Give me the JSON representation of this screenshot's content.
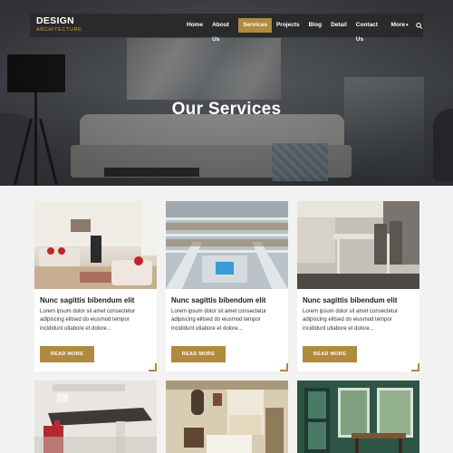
{
  "brand": {
    "name": "DESIGN",
    "tagline": "ARCHITECTURE"
  },
  "nav": {
    "items": [
      {
        "label": "Home",
        "active": false
      },
      {
        "label": "About Us",
        "active": false
      },
      {
        "label": "Services",
        "active": true
      },
      {
        "label": "Projects",
        "active": false
      },
      {
        "label": "Blog",
        "active": false
      },
      {
        "label": "Detail",
        "active": false
      },
      {
        "label": "Contact Us",
        "active": false
      },
      {
        "label": "More",
        "active": false
      }
    ],
    "search_icon": "search-icon"
  },
  "hero": {
    "title": "Our Services"
  },
  "cards": [
    {
      "title": "Nunc sagittis bibendum elit",
      "text": "Lorem ipsum dolor sit amet consectetur adipiscing elitsed do eiusmod tempor incididunt utlabore et dolore...",
      "button": "READ MORE",
      "image": "living-room"
    },
    {
      "title": "Nunc sagittis bibendum elit",
      "text": "Lorem ipsum dolor sit amet consectetur adipiscing elitsed do eiusmod tempor incididunt utlabore et dolore...",
      "button": "READ MORE",
      "image": "library"
    },
    {
      "title": "Nunc sagittis bibendum elit",
      "text": "Lorem ipsum dolor sit amet consectetur adipiscing elitsed do eiusmod tempor incididunt utlabore et dolore...",
      "button": "READ MORE",
      "image": "dining-room"
    },
    {
      "image": "kitchen"
    },
    {
      "image": "bedroom"
    },
    {
      "image": "green-room"
    }
  ],
  "colors": {
    "accent": "#b08a3e",
    "nav_bg": "#2a2a2a",
    "page_bg": "#f2f2f2"
  }
}
